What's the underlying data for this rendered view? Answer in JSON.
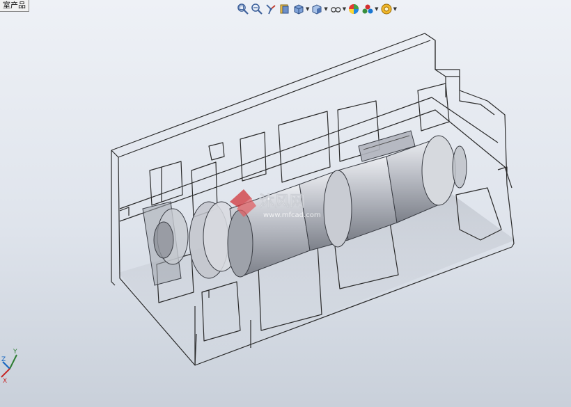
{
  "document_tab": {
    "label": "室产品"
  },
  "toolbar": {
    "buttons": [
      {
        "name": "zoom-to-fit",
        "icon": "zoom-fit-icon",
        "has_dropdown": false
      },
      {
        "name": "zoom-to-area",
        "icon": "zoom-area-icon",
        "has_dropdown": false
      },
      {
        "name": "previous-view",
        "icon": "previous-view-icon",
        "has_dropdown": false
      },
      {
        "name": "section-view",
        "icon": "section-view-icon",
        "has_dropdown": false
      },
      {
        "name": "view-orientation",
        "icon": "view-orientation-icon",
        "has_dropdown": true
      },
      {
        "name": "display-style",
        "icon": "display-style-icon",
        "has_dropdown": true
      },
      {
        "name": "hide-show-items",
        "icon": "hide-show-icon",
        "has_dropdown": true
      },
      {
        "name": "edit-appearance",
        "icon": "appearance-icon",
        "has_dropdown": false
      },
      {
        "name": "apply-scene",
        "icon": "scene-icon",
        "has_dropdown": true
      },
      {
        "name": "view-settings",
        "icon": "view-settings-icon",
        "has_dropdown": true
      }
    ]
  },
  "watermark": {
    "text_main": "沐风网",
    "text_sub": "www.mfcad.com"
  },
  "triad": {
    "x_label": "X",
    "y_label": "Y",
    "z_label": "Z"
  },
  "colors": {
    "background_top": "#eef1f6",
    "background_bottom": "#c9d0da",
    "edge_line": "#2a2a2a",
    "part_fill": "#b9bcc4",
    "watermark": "#d2363b"
  }
}
